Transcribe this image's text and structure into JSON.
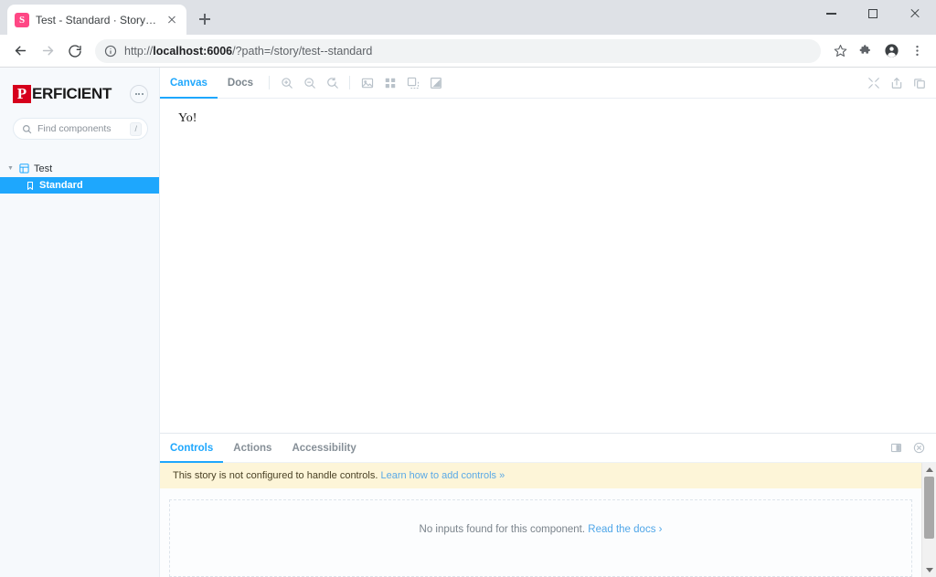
{
  "browser": {
    "tab": {
      "title": "Test - Standard · Storybook",
      "favicon_letter": "S",
      "favicon_color": "#ff4785"
    },
    "new_tab_label": "New tab",
    "window_controls": {
      "minimize": "Minimize",
      "maximize": "Maximize",
      "close": "Close"
    },
    "nav": {
      "back": "Back",
      "forward": "Forward",
      "reload": "Reload"
    },
    "omnibox": {
      "info_icon": "info-circle-icon",
      "url_prefix": "http://",
      "url_host": "localhost:6006",
      "url_suffix": "/?path=/story/test--standard",
      "full_url": "http://localhost:6006/?path=/story/test--standard"
    },
    "actions": {
      "bookmark": "Bookmark this tab",
      "extensions": "Extensions",
      "profile": "Profile",
      "menu": "Customize and control Google Chrome"
    }
  },
  "sidebar": {
    "logo": {
      "mark": "P",
      "text": "ERFICIENT",
      "mark_color": "#d6001c"
    },
    "menu_button": "menu-dots-button",
    "search": {
      "placeholder": "Find components",
      "shortcut": "/"
    },
    "tree": [
      {
        "label": "Test",
        "type": "component",
        "expanded": true,
        "icon": "component-grid-icon"
      },
      {
        "label": "Standard",
        "type": "story",
        "selected": true,
        "icon": "bookmark-icon"
      }
    ]
  },
  "preview": {
    "tabs": [
      {
        "label": "Canvas",
        "active": true
      },
      {
        "label": "Docs",
        "active": false
      }
    ],
    "zoom_tools": [
      {
        "name": "zoom-in-icon",
        "title": "Zoom in"
      },
      {
        "name": "zoom-out-icon",
        "title": "Zoom out"
      },
      {
        "name": "zoom-reset-icon",
        "title": "Reset zoom"
      }
    ],
    "view_tools": [
      {
        "name": "backgrounds-icon",
        "title": "Change the background of the preview"
      },
      {
        "name": "grid-icon",
        "title": "Apply a grid to the preview"
      },
      {
        "name": "measure-icon",
        "title": "Enable measure"
      },
      {
        "name": "outline-icon",
        "title": "Apply outlines to the preview"
      }
    ],
    "right_tools": [
      {
        "name": "fullscreen-icon",
        "title": "Go full screen"
      },
      {
        "name": "open-new-tab-icon",
        "title": "Open canvas in new tab"
      },
      {
        "name": "copy-link-icon",
        "title": "Copy canvas link"
      }
    ],
    "story_content": "Yo!"
  },
  "addons": {
    "tabs": [
      {
        "label": "Controls",
        "active": true
      },
      {
        "label": "Actions",
        "active": false
      },
      {
        "label": "Accessibility",
        "active": false
      }
    ],
    "right_tools": [
      {
        "name": "panel-position-icon",
        "title": "Change addon orientation"
      },
      {
        "name": "close-panel-icon",
        "title": "Hide addons"
      }
    ],
    "warning": {
      "text": "This story is not configured to handle controls.",
      "link_text": "Learn how to add controls »",
      "background": "#fdf5d8"
    },
    "empty": {
      "text": "No inputs found for this component.",
      "link_text": "Read the docs ›"
    }
  },
  "theme": {
    "accent": "#1ea7fd",
    "sidebar_bg": "#f6f9fc",
    "selected_bg": "#1ea7fd"
  }
}
